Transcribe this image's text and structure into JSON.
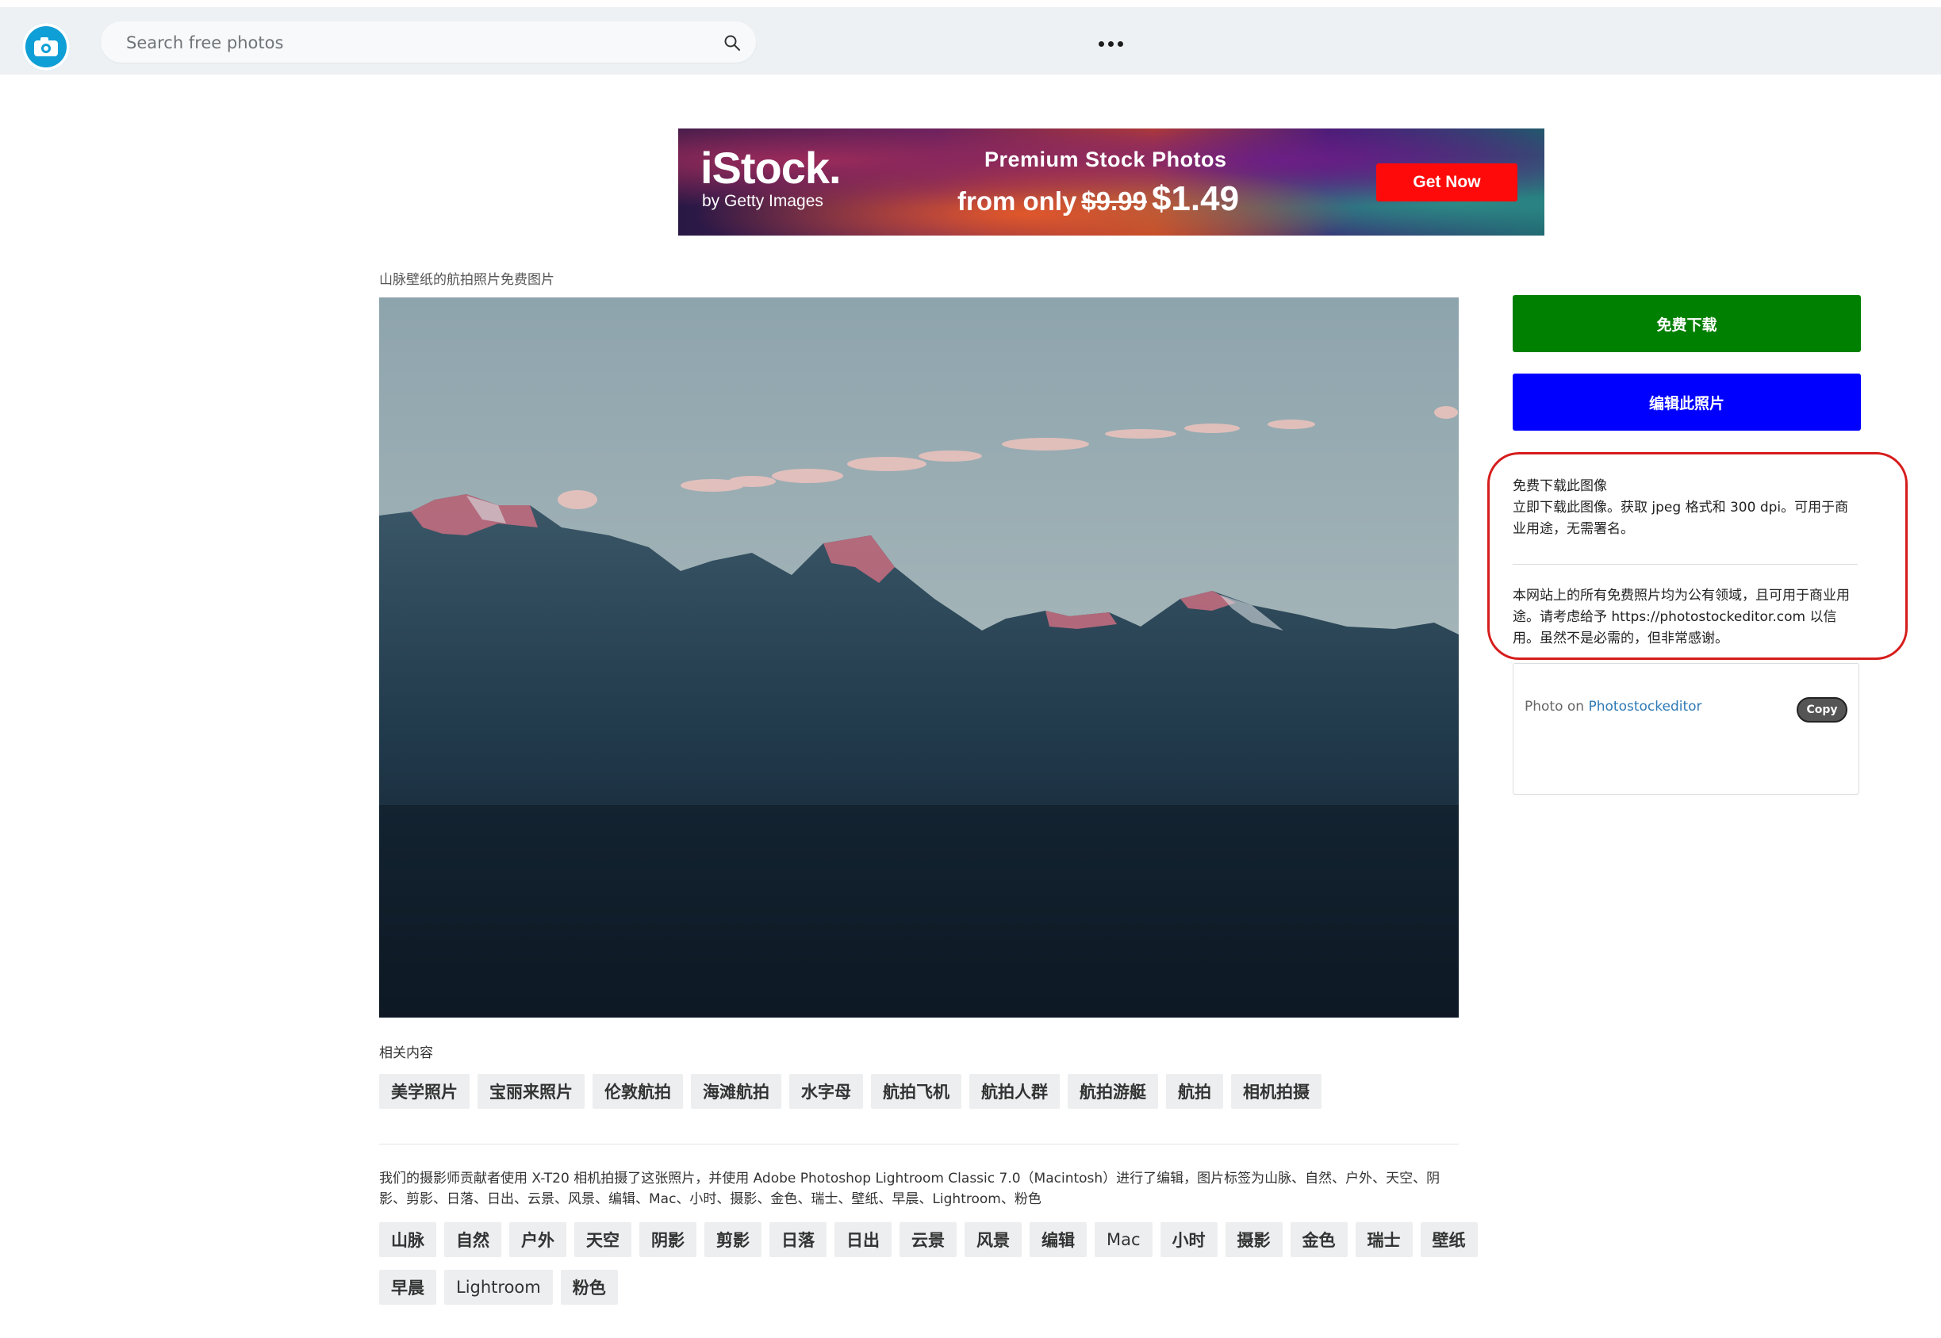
{
  "header": {
    "search_placeholder": "Search free photos"
  },
  "ad": {
    "brand": "iStock.",
    "sub": "by Getty Images",
    "headline": "Premium Stock Photos",
    "price_prefix": "from only",
    "old_price": "$9.99",
    "new_price": "$1.49",
    "cta": "Get Now"
  },
  "photo": {
    "caption": "山脉壁纸的航拍照片免费图片"
  },
  "sidebar": {
    "download_label": "免费下载",
    "edit_label": "编辑此照片",
    "info_title": "免费下载此图像",
    "info_body": "立即下载此图像。获取 jpeg 格式和 300 dpi。可用于商业用途，无需署名。",
    "license_text": "本网站上的所有免费照片均为公有领域，且可用于商业用途。请考虑给予 https://photostockeditor.com 以信用。虽然不是必需的，但非常感谢。",
    "credit_prefix": "Photo on",
    "credit_link": "Photostockeditor",
    "copy_label": "Copy"
  },
  "related": {
    "title": "相关内容",
    "tags": [
      "美学照片",
      "宝丽来照片",
      "伦敦航拍",
      "海滩航拍",
      "水字母",
      "航拍飞机",
      "航拍人群",
      "航拍游艇",
      "航拍",
      "相机拍摄"
    ]
  },
  "description": {
    "text": "我们的摄影师贡献者使用 X-T20 相机拍摄了这张照片，并使用 Adobe Photoshop Lightroom Classic 7.0（Macintosh）进行了编辑，图片标签为山脉、自然、户外、天空、阴影、剪影、日落、日出、云景、风景、编辑、Mac、小时、摄影、金色、瑞士、壁纸、早晨、Lightroom、粉色",
    "tags_row1": [
      "山脉",
      "自然",
      "户外",
      "天空",
      "阴影",
      "剪影",
      "日落",
      "日出",
      "云景",
      "风景",
      "编辑",
      "Mac",
      "小时",
      "摄影",
      "金色",
      "瑞士",
      "壁纸"
    ],
    "tags_row2": [
      "早晨",
      "Lightroom",
      "粉色"
    ]
  },
  "colors": {
    "download": "#008000",
    "edit": "#0000ff",
    "highlight": "#d61c1c",
    "logo": "#0e9fd6"
  }
}
